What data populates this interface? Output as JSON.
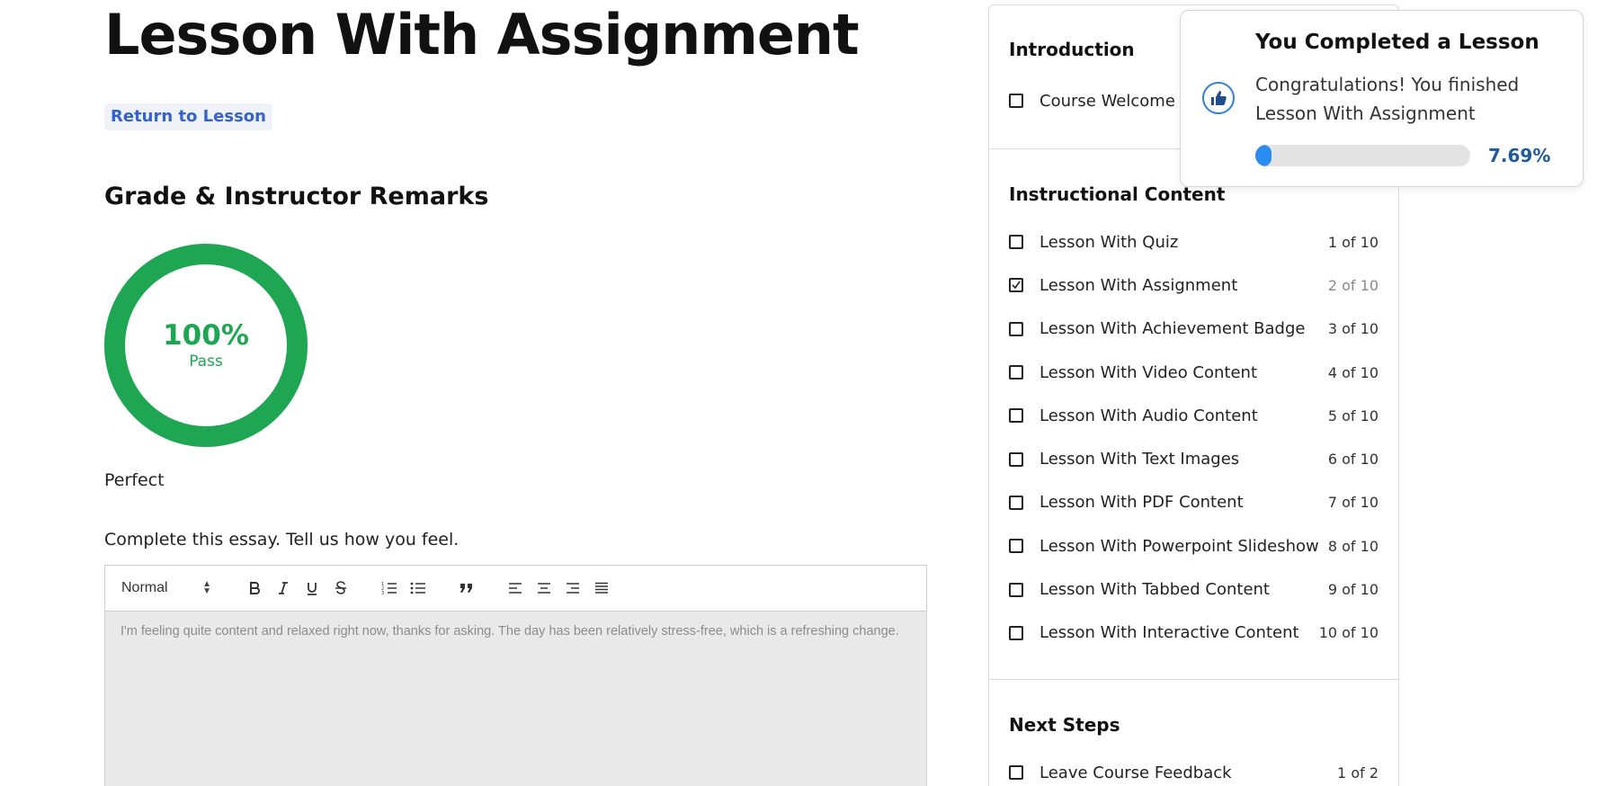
{
  "page": {
    "title": "Lesson With Assignment",
    "return_link": "Return to Lesson"
  },
  "grade": {
    "heading": "Grade & Instructor Remarks",
    "percent": "100%",
    "percent_value": 100,
    "status": "Pass",
    "remark": "Perfect",
    "color": "#1fa653"
  },
  "assignment": {
    "prompt": "Complete this essay. Tell us how you feel.",
    "format_select": "Normal",
    "toolbar_icons": [
      "bold-icon",
      "italic-icon",
      "underline-icon",
      "strikethrough-icon",
      "ordered-list-icon",
      "bullet-list-icon",
      "blockquote-icon",
      "align-left-icon",
      "align-center-icon",
      "align-right-icon",
      "align-justify-icon"
    ],
    "answer": "I'm feeling quite content and relaxed right now, thanks for asking. The day has been relatively stress-free, which is a refreshing change."
  },
  "sidebar": {
    "sections": [
      {
        "title": "Introduction",
        "items": [
          {
            "label": "Course Welcome",
            "position": "",
            "checked": false
          }
        ]
      },
      {
        "title": "Instructional Content",
        "items": [
          {
            "label": "Lesson With Quiz",
            "position": "1 of 10",
            "checked": false
          },
          {
            "label": "Lesson With Assignment",
            "position": "2 of 10",
            "checked": true
          },
          {
            "label": "Lesson With Achievement Badge",
            "position": "3 of 10",
            "checked": false
          },
          {
            "label": "Lesson With Video Content",
            "position": "4 of 10",
            "checked": false
          },
          {
            "label": "Lesson With Audio Content",
            "position": "5 of 10",
            "checked": false
          },
          {
            "label": "Lesson With Text Images",
            "position": "6 of 10",
            "checked": false
          },
          {
            "label": "Lesson With PDF Content",
            "position": "7 of 10",
            "checked": false
          },
          {
            "label": "Lesson With Powerpoint Slideshow",
            "position": "8 of 10",
            "checked": false
          },
          {
            "label": "Lesson With Tabbed Content",
            "position": "9 of 10",
            "checked": false
          },
          {
            "label": "Lesson With Interactive Content",
            "position": "10 of 10",
            "checked": false
          }
        ]
      },
      {
        "title": "Next Steps",
        "items": [
          {
            "label": "Leave Course Feedback",
            "position": "1 of 2",
            "checked": false
          }
        ]
      }
    ]
  },
  "toast": {
    "title": "You Completed a Lesson",
    "message": "Congratulations! You finished Lesson With Assignment",
    "progress_text": "7.69%",
    "progress_value": 0.0769,
    "icon": "thumbs-up-icon",
    "accent": "#2b8cf0"
  }
}
